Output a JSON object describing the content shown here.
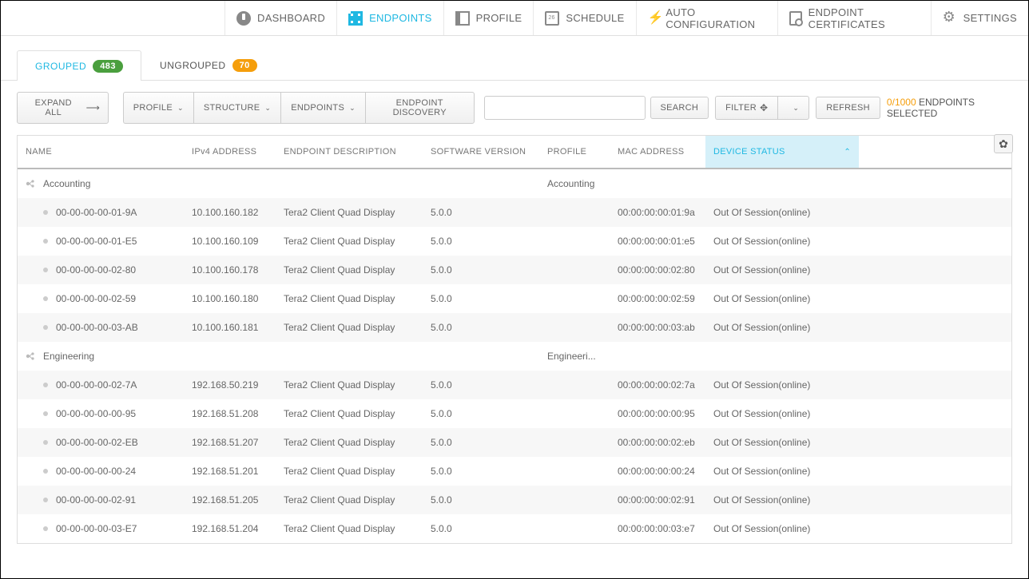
{
  "nav": {
    "dashboard": "DASHBOARD",
    "endpoints": "ENDPOINTS",
    "profile": "PROFILE",
    "schedule": "SCHEDULE",
    "auto": "AUTO CONFIGURATION",
    "cert": "ENDPOINT CERTIFICATES",
    "settings": "SETTINGS"
  },
  "tabs": {
    "grouped": {
      "label": "GROUPED",
      "count": "483"
    },
    "ungrouped": {
      "label": "UNGROUPED",
      "count": "70"
    }
  },
  "toolbar": {
    "expand_all": "EXPAND ALL",
    "profile": "PROFILE",
    "structure": "STRUCTURE",
    "endpoints": "ENDPOINTS",
    "discovery": "ENDPOINT DISCOVERY",
    "search": "SEARCH",
    "filter": "FILTER",
    "refresh": "REFRESH",
    "search_placeholder": ""
  },
  "selection": {
    "current": "0",
    "total": "1000",
    "label": "ENDPOINTS SELECTED"
  },
  "columns": {
    "name": "NAME",
    "ip": "IPv4 ADDRESS",
    "desc": "ENDPOINT DESCRIPTION",
    "ver": "SOFTWARE VERSION",
    "profile": "PROFILE",
    "mac": "MAC ADDRESS",
    "status": "DEVICE STATUS"
  },
  "groups": [
    {
      "name": "Accounting",
      "profile": "Accounting",
      "rows": [
        {
          "name": "00-00-00-00-01-9A",
          "ip": "10.100.160.182",
          "desc": "Tera2 Client Quad Display",
          "ver": "5.0.0",
          "mac": "00:00:00:00:01:9a",
          "status": "Out Of Session(online)"
        },
        {
          "name": "00-00-00-00-01-E5",
          "ip": "10.100.160.109",
          "desc": "Tera2 Client Quad Display",
          "ver": "5.0.0",
          "mac": "00:00:00:00:01:e5",
          "status": "Out Of Session(online)"
        },
        {
          "name": "00-00-00-00-02-80",
          "ip": "10.100.160.178",
          "desc": "Tera2 Client Quad Display",
          "ver": "5.0.0",
          "mac": "00:00:00:00:02:80",
          "status": "Out Of Session(online)"
        },
        {
          "name": "00-00-00-00-02-59",
          "ip": "10.100.160.180",
          "desc": "Tera2 Client Quad Display",
          "ver": "5.0.0",
          "mac": "00:00:00:00:02:59",
          "status": "Out Of Session(online)"
        },
        {
          "name": "00-00-00-00-03-AB",
          "ip": "10.100.160.181",
          "desc": "Tera2 Client Quad Display",
          "ver": "5.0.0",
          "mac": "00:00:00:00:03:ab",
          "status": "Out Of Session(online)"
        }
      ]
    },
    {
      "name": "Engineering",
      "profile": "Engineeri...",
      "rows": [
        {
          "name": "00-00-00-00-02-7A",
          "ip": "192.168.50.219",
          "desc": "Tera2 Client Quad Display",
          "ver": "5.0.0",
          "mac": "00:00:00:00:02:7a",
          "status": "Out Of Session(online)"
        },
        {
          "name": "00-00-00-00-00-95",
          "ip": "192.168.51.208",
          "desc": "Tera2 Client Quad Display",
          "ver": "5.0.0",
          "mac": "00:00:00:00:00:95",
          "status": "Out Of Session(online)"
        },
        {
          "name": "00-00-00-00-02-EB",
          "ip": "192.168.51.207",
          "desc": "Tera2 Client Quad Display",
          "ver": "5.0.0",
          "mac": "00:00:00:00:02:eb",
          "status": "Out Of Session(online)"
        },
        {
          "name": "00-00-00-00-00-24",
          "ip": "192.168.51.201",
          "desc": "Tera2 Client Quad Display",
          "ver": "5.0.0",
          "mac": "00:00:00:00:00:24",
          "status": "Out Of Session(online)"
        },
        {
          "name": "00-00-00-00-02-91",
          "ip": "192.168.51.205",
          "desc": "Tera2 Client Quad Display",
          "ver": "5.0.0",
          "mac": "00:00:00:00:02:91",
          "status": "Out Of Session(online)"
        },
        {
          "name": "00-00-00-00-03-E7",
          "ip": "192.168.51.204",
          "desc": "Tera2 Client Quad Display",
          "ver": "5.0.0",
          "mac": "00:00:00:00:03:e7",
          "status": "Out Of Session(online)"
        }
      ]
    }
  ]
}
